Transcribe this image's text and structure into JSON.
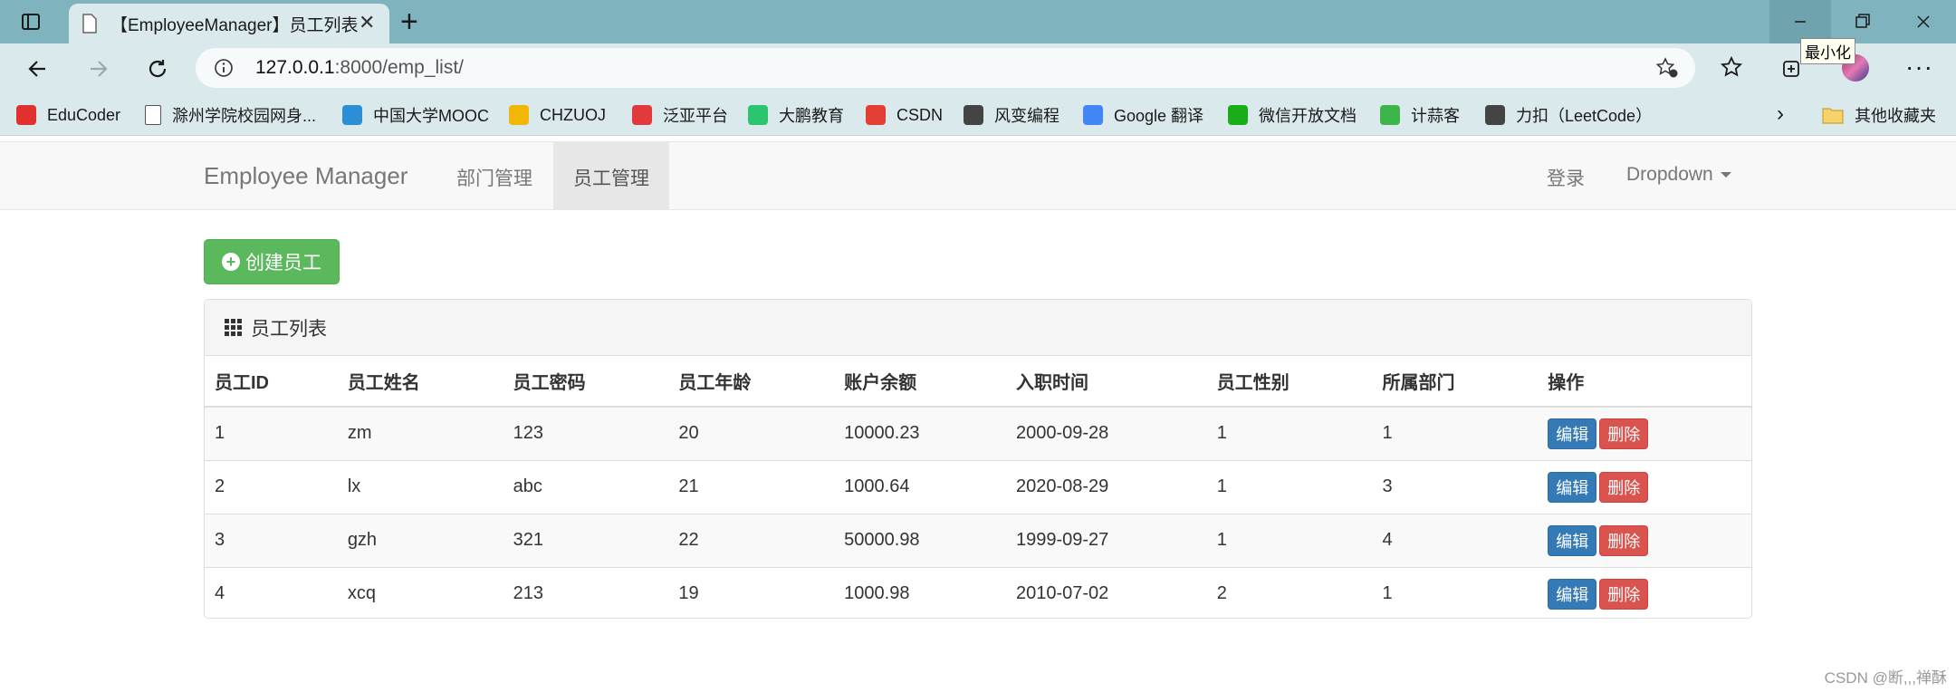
{
  "browser": {
    "tab_title": "【EmployeeManager】员工列表",
    "tooltip": "最小化",
    "address_host": "127.0.0.1",
    "address_rest": ":8000/emp_list/",
    "bookmarks": [
      {
        "label": "EduCoder",
        "icon": "toutiao-icon",
        "color": "#e0312f"
      },
      {
        "label": "滁州学院校园网身...",
        "icon": "page-icon",
        "color": "#ffffff"
      },
      {
        "label": "中国大学MOOC",
        "icon": "mooc-icon",
        "color": "#2c8fd6"
      },
      {
        "label": "CHZUOJ",
        "icon": "chzuoj-icon",
        "color": "#f2b705"
      },
      {
        "label": "泛亚平台",
        "icon": "fanya-icon",
        "color": "#e03a3a"
      },
      {
        "label": "大鹏教育",
        "icon": "dapeng-icon",
        "color": "#2cc56f"
      },
      {
        "label": "CSDN",
        "icon": "csdn-icon",
        "color": "#e33e33"
      },
      {
        "label": "风变编程",
        "icon": "panda-icon",
        "color": "#444444"
      },
      {
        "label": "Google 翻译",
        "icon": "google-translate-icon",
        "color": "#4285f4"
      },
      {
        "label": "微信开放文档",
        "icon": "wechat-icon",
        "color": "#1aad19"
      },
      {
        "label": "计蒜客",
        "icon": "jisuanke-icon",
        "color": "#3cb64a"
      },
      {
        "label": "力扣（LeetCode）",
        "icon": "leetcode-icon",
        "color": "#444444"
      }
    ],
    "other_bookmarks": "其他收藏夹"
  },
  "navbar": {
    "brand": "Employee Manager",
    "links": [
      "部门管理",
      "员工管理"
    ],
    "login": "登录",
    "dropdown": "Dropdown"
  },
  "create_button": "创建员工",
  "panel": {
    "title": "员工列表",
    "columns": [
      "员工ID",
      "员工姓名",
      "员工密码",
      "员工年龄",
      "账户余额",
      "入职时间",
      "员工性别",
      "所属部门",
      "操作"
    ],
    "rows": [
      [
        "1",
        "zm",
        "123",
        "20",
        "10000.23",
        "2000-09-28",
        "1",
        "1"
      ],
      [
        "2",
        "lx",
        "abc",
        "21",
        "1000.64",
        "2020-08-29",
        "1",
        "3"
      ],
      [
        "3",
        "gzh",
        "321",
        "22",
        "50000.98",
        "1999-09-27",
        "1",
        "4"
      ],
      [
        "4",
        "xcq",
        "213",
        "19",
        "1000.98",
        "2010-07-02",
        "2",
        "1"
      ]
    ],
    "edit_label": "编辑",
    "delete_label": "删除"
  },
  "watermark": "CSDN @断,,,禅酥"
}
